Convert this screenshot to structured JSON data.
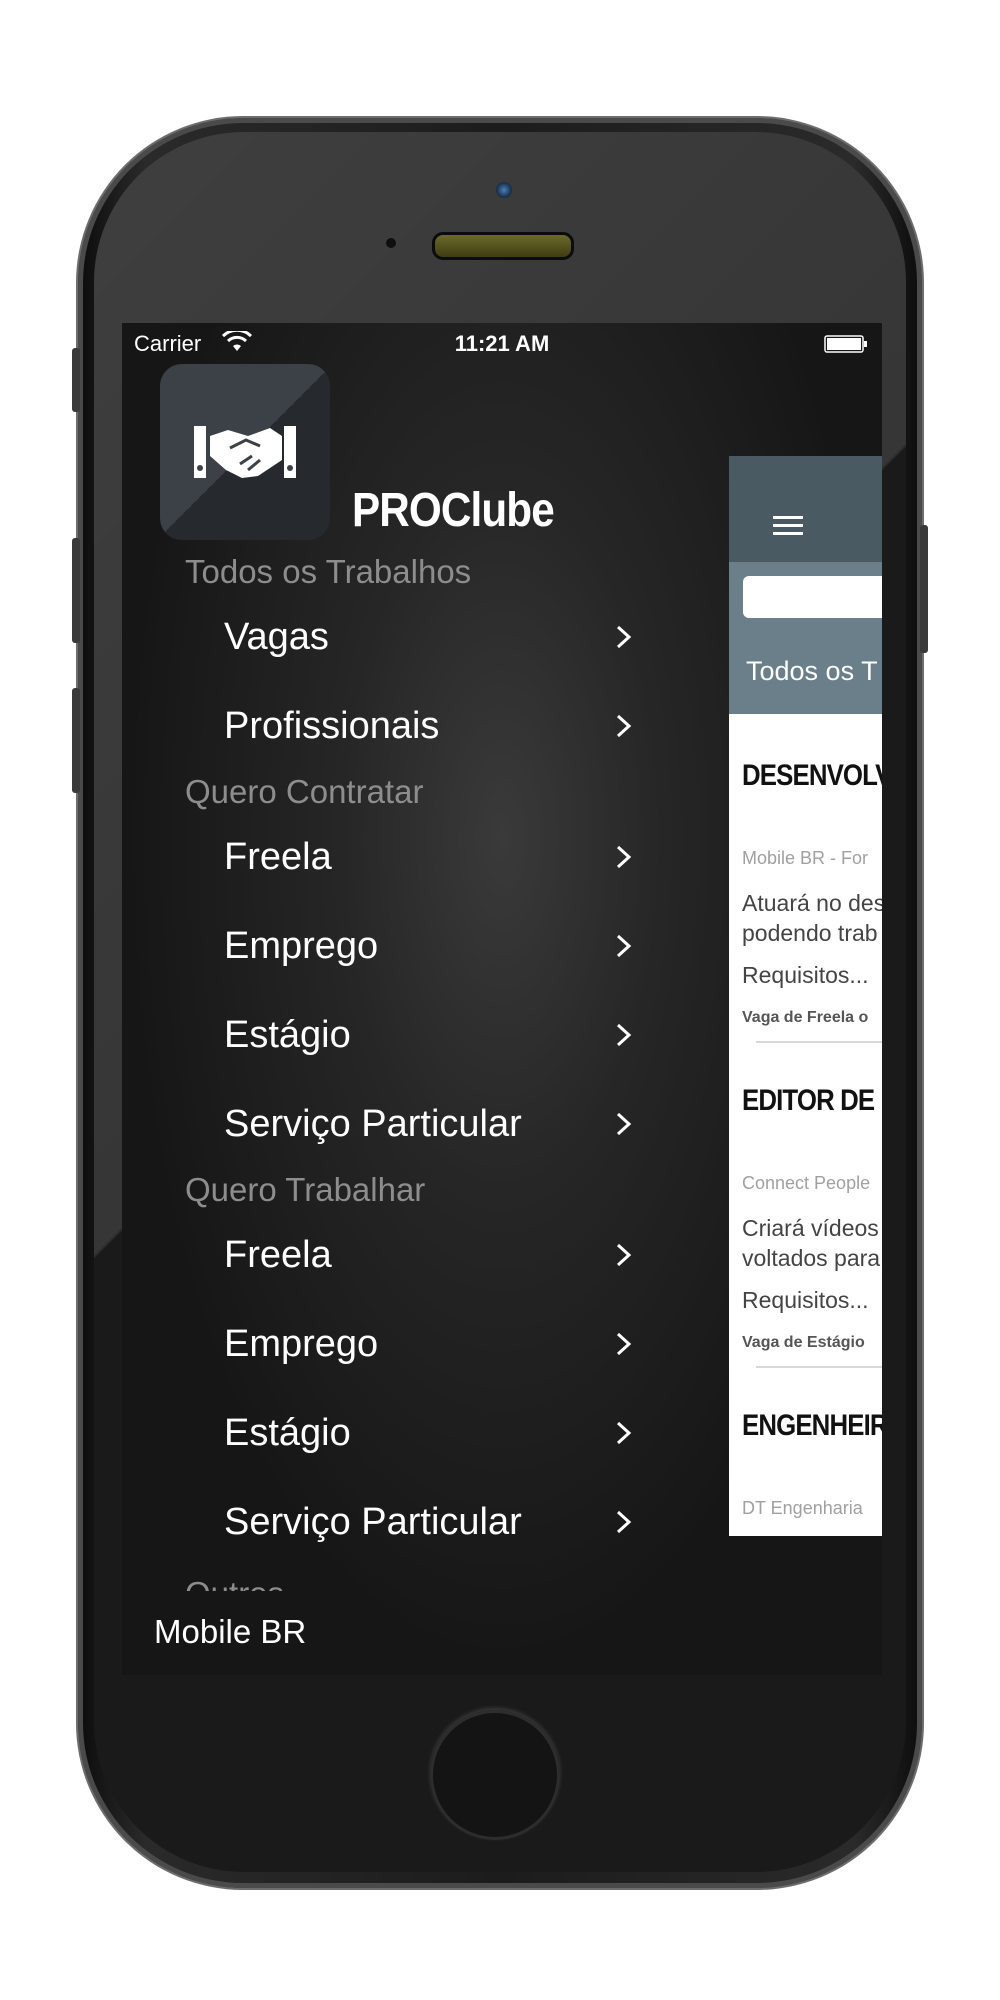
{
  "status_bar": {
    "carrier": "Carrier",
    "time": "11:21 AM"
  },
  "drawer": {
    "app_title": "PROClube",
    "sections": [
      {
        "header": "Todos os Trabalhos",
        "items": [
          "Vagas",
          "Profissionais"
        ]
      },
      {
        "header": "Quero Contratar",
        "items": [
          "Freela",
          "Emprego",
          "Estágio",
          "Serviço Particular"
        ]
      },
      {
        "header": "Quero Trabalhar",
        "items": [
          "Freela",
          "Emprego",
          "Estágio",
          "Serviço Particular"
        ]
      }
    ],
    "partial_header": "Outros",
    "footer_user": "Mobile BR"
  },
  "content": {
    "filter_title": "Todos os T",
    "jobs": [
      {
        "title": "DESENVOLV",
        "company": "Mobile BR - For",
        "desc1": "Atuará no des",
        "desc2": "podendo trab",
        "req": "Requisitos...",
        "type": "Vaga de Freela o"
      },
      {
        "title": "EDITOR DE",
        "company": "Connect People",
        "desc1": "Criará vídeos",
        "desc2": "voltados para",
        "req": "Requisitos...",
        "type": "Vaga de Estágio"
      },
      {
        "title": "ENGENHEIR",
        "company": "DT Engenharia"
      }
    ]
  }
}
